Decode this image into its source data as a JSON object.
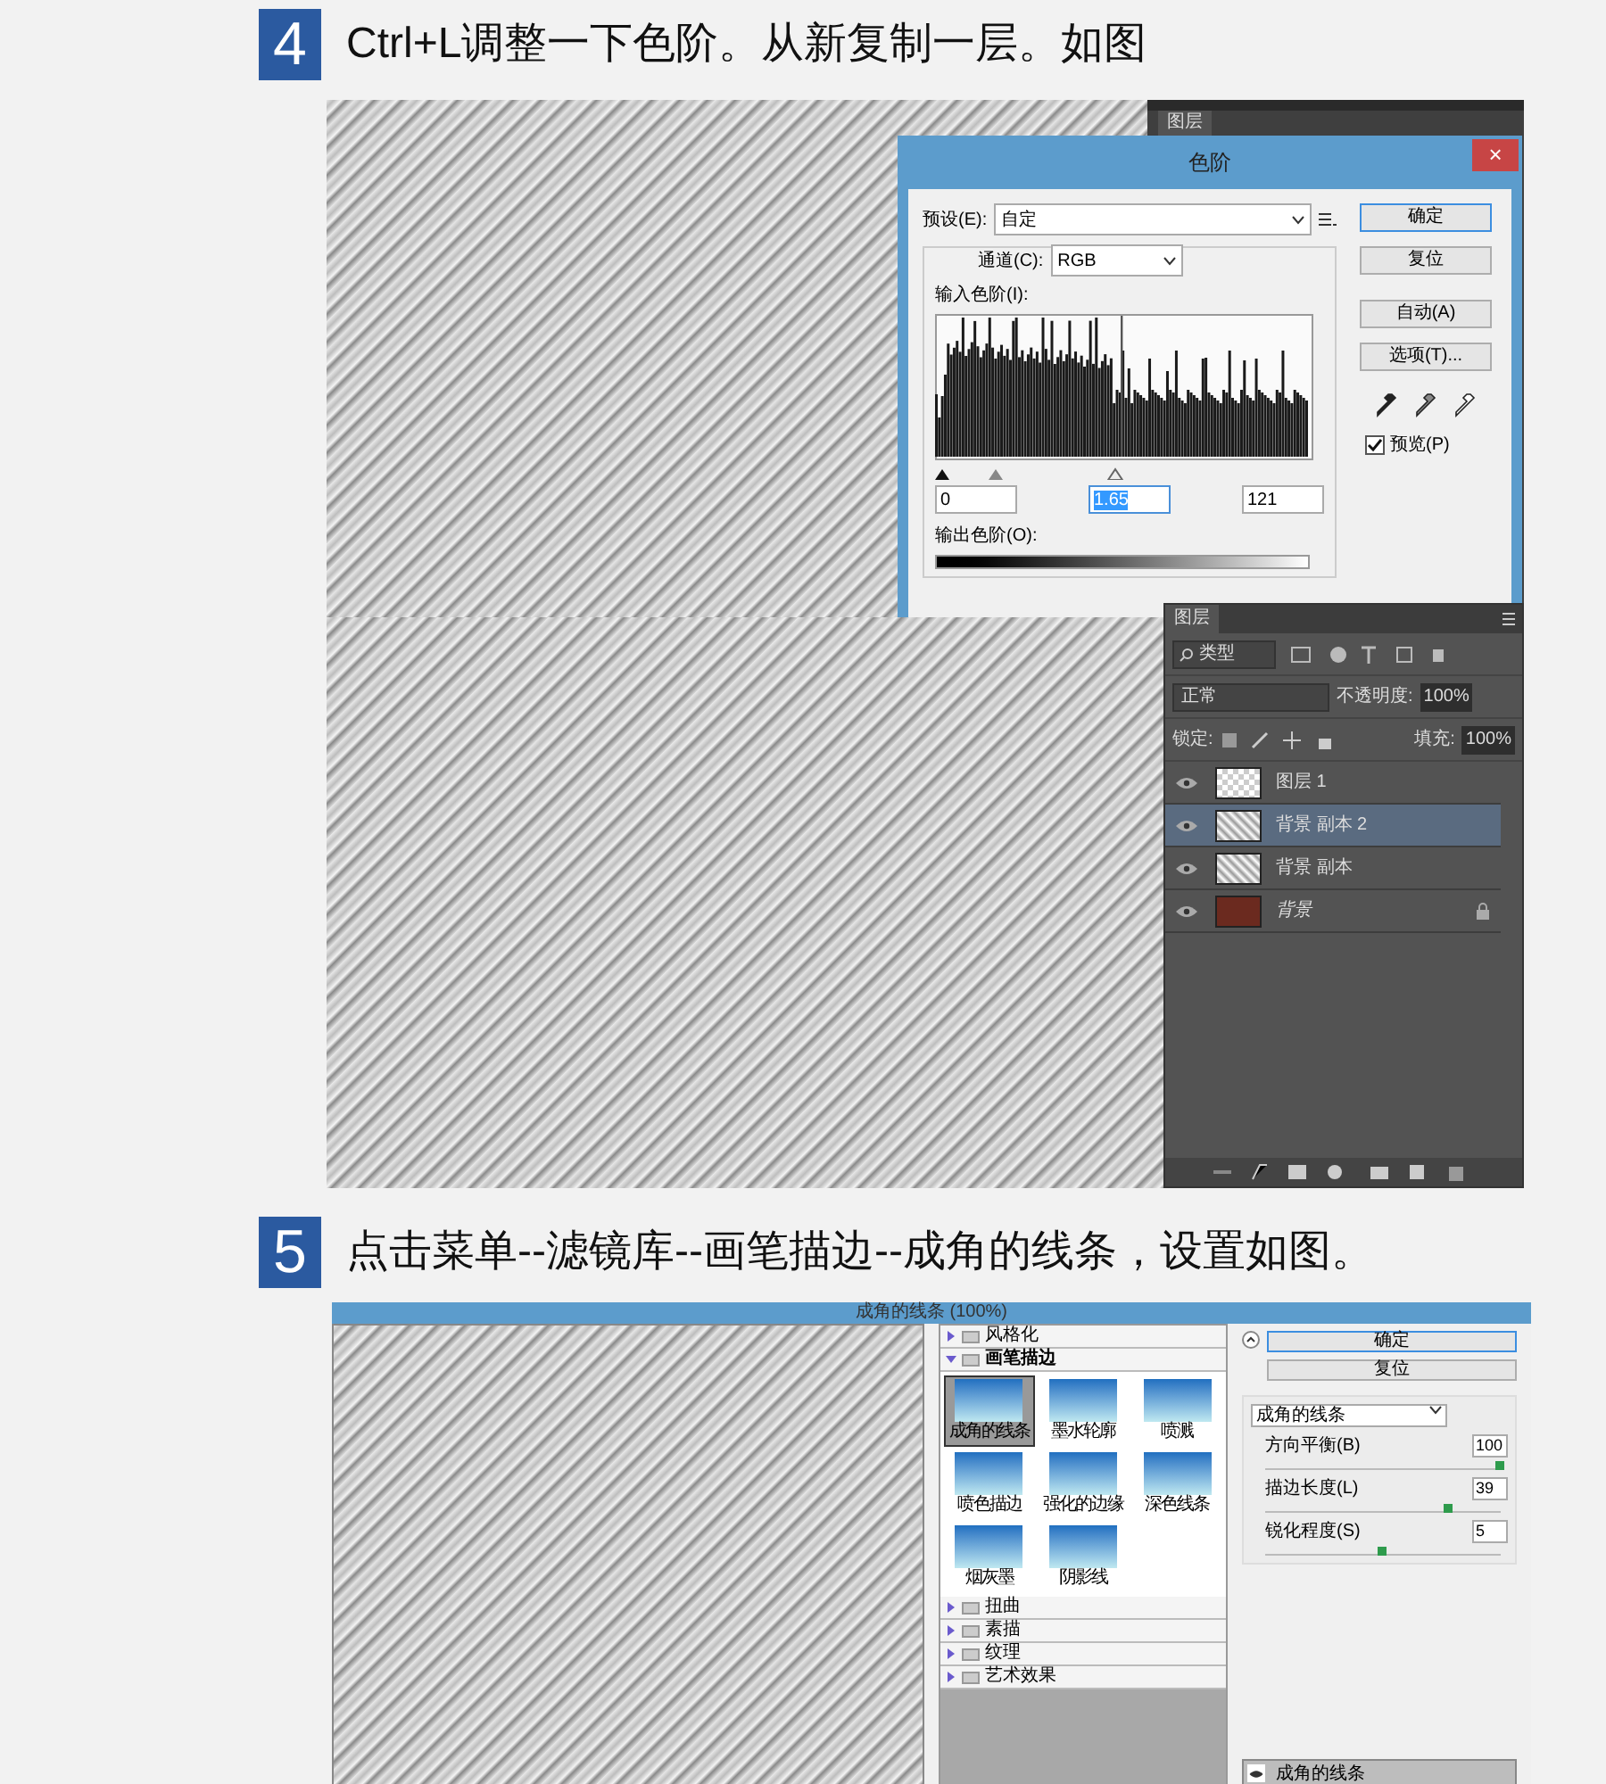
{
  "steps": [
    {
      "number": "4",
      "text": "Ctrl+L调整一下色阶。从新复制一层。如图"
    },
    {
      "number": "5",
      "text": "点击菜单--滤镜库--画笔描边--成角的线条，设置如图。"
    }
  ],
  "levels_screenshot": {
    "back_panel_tab": "图层",
    "dialog": {
      "title": "色阶",
      "close": "×",
      "preset_label": "预设(E):",
      "preset_value": "自定",
      "channel_label": "通道(C):",
      "channel_value": "RGB",
      "input_label": "输入色阶(I):",
      "inputs": [
        "0",
        "1.65",
        "121"
      ],
      "output_label": "输出色阶(O):",
      "buttons": [
        {
          "label": "确定",
          "default": true
        },
        {
          "label": "复位",
          "default": false
        },
        {
          "label": "自动(A)",
          "default": false
        },
        {
          "label": "选项(T)...",
          "default": false
        }
      ],
      "preview": {
        "label": "预览(P)",
        "checked": true
      }
    },
    "layers_panel": {
      "tab": "图层",
      "filter": "类型",
      "blend_mode": "正常",
      "opacity_label": "不透明度:",
      "opacity": "100%",
      "lock_label": "锁定:",
      "fill_label": "填充:",
      "fill": "100%",
      "layers": [
        {
          "name": "图层 1",
          "kind": "transparent",
          "selected": false,
          "visible": true,
          "locked": false
        },
        {
          "name": "背景 副本 2",
          "kind": "sketch",
          "selected": true,
          "visible": true,
          "locked": false
        },
        {
          "name": "背景 副本",
          "kind": "sketch",
          "selected": false,
          "visible": true,
          "locked": false
        },
        {
          "name": "背景",
          "kind": "background",
          "selected": false,
          "visible": true,
          "locked": true
        }
      ]
    }
  },
  "filter_screenshot": {
    "title": "成角的线条 (100%)",
    "folders": [
      {
        "name": "风格化",
        "expanded": false
      },
      {
        "name": "画笔描边",
        "expanded": true,
        "filters": [
          {
            "name": "成角的线条",
            "selected": true
          },
          {
            "name": "墨水轮廓",
            "selected": false
          },
          {
            "name": "喷溅",
            "selected": false
          },
          {
            "name": "喷色描边",
            "selected": false
          },
          {
            "name": "强化的边缘",
            "selected": false
          },
          {
            "name": "深色线条",
            "selected": false
          },
          {
            "name": "烟灰墨",
            "selected": false
          },
          {
            "name": "阴影线",
            "selected": false
          }
        ]
      },
      {
        "name": "扭曲",
        "expanded": false
      },
      {
        "name": "素描",
        "expanded": false
      },
      {
        "name": "纹理",
        "expanded": false
      },
      {
        "name": "艺术效果",
        "expanded": false
      }
    ],
    "buttons": [
      {
        "label": "确定",
        "default": true
      },
      {
        "label": "复位",
        "default": false
      }
    ],
    "filter_select": "成角的线条",
    "params": [
      {
        "label": "方向平衡(B)",
        "value": "100",
        "level": 1.0
      },
      {
        "label": "描边长度(L)",
        "value": "39",
        "level": 0.78
      },
      {
        "label": "锐化程度(S)",
        "value": "5",
        "level": 0.5
      }
    ],
    "effect_layer": "成角的线条"
  }
}
